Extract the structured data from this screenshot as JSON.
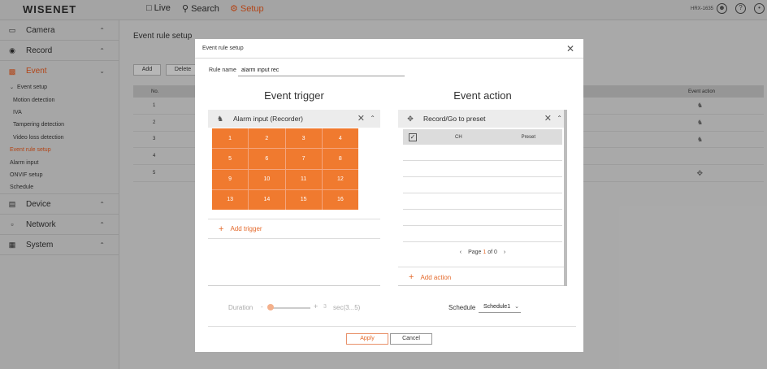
{
  "topbar": {
    "logo": "WISENET",
    "nav": [
      {
        "label": "Live",
        "icon": "monitor-icon"
      },
      {
        "label": "Search",
        "icon": "search-icon"
      },
      {
        "label": "Setup",
        "icon": "gear-icon"
      }
    ],
    "model": "HRX-1635"
  },
  "sidebar": {
    "sections": [
      {
        "label": "Camera",
        "icon": "camera-icon"
      },
      {
        "label": "Record",
        "icon": "record-icon"
      },
      {
        "label": "Event",
        "icon": "event-icon"
      },
      {
        "label": "Device",
        "icon": "device-icon"
      },
      {
        "label": "Network",
        "icon": "network-icon"
      },
      {
        "label": "System",
        "icon": "system-icon"
      }
    ],
    "event_items": [
      "Event setup",
      "Motion detection",
      "IVA",
      "Tampering detection",
      "Video loss detection",
      "Event rule setup",
      "Alarm input",
      "ONVIF setup",
      "Schedule"
    ]
  },
  "main": {
    "title": "Event rule setup",
    "add_label": "Add",
    "delete_label": "Delete",
    "table": {
      "col_no": "No.",
      "col_action": "Event action",
      "rows": [
        "1",
        "2",
        "3",
        "4",
        "5"
      ]
    }
  },
  "modal": {
    "title": "Event rule setup",
    "rule_name_label": "Rule name",
    "rule_name_value": "alarm input rec",
    "trigger": {
      "heading": "Event trigger",
      "panel_title": "Alarm input (Recorder)",
      "channels": [
        "1",
        "2",
        "3",
        "4",
        "5",
        "6",
        "7",
        "8",
        "9",
        "10",
        "11",
        "12",
        "13",
        "14",
        "15",
        "16"
      ],
      "add_label": "Add trigger"
    },
    "action": {
      "heading": "Event action",
      "panel_title": "Record/Go to preset",
      "col_ch": "CH",
      "col_preset": "Preset",
      "pager_prefix": "Page",
      "pager_current": "1",
      "pager_of": "of 0",
      "add_label": "Add action"
    },
    "duration": {
      "label": "Duration",
      "minus": "-",
      "plus": "+",
      "value": "3",
      "unit": "sec(3...5)"
    },
    "schedule": {
      "label": "Schedule",
      "value": "Schedule1"
    },
    "apply_label": "Apply",
    "cancel_label": "Cancel"
  },
  "colors": {
    "accent": "#e46a2c",
    "channel_cell": "#f07a2f"
  }
}
